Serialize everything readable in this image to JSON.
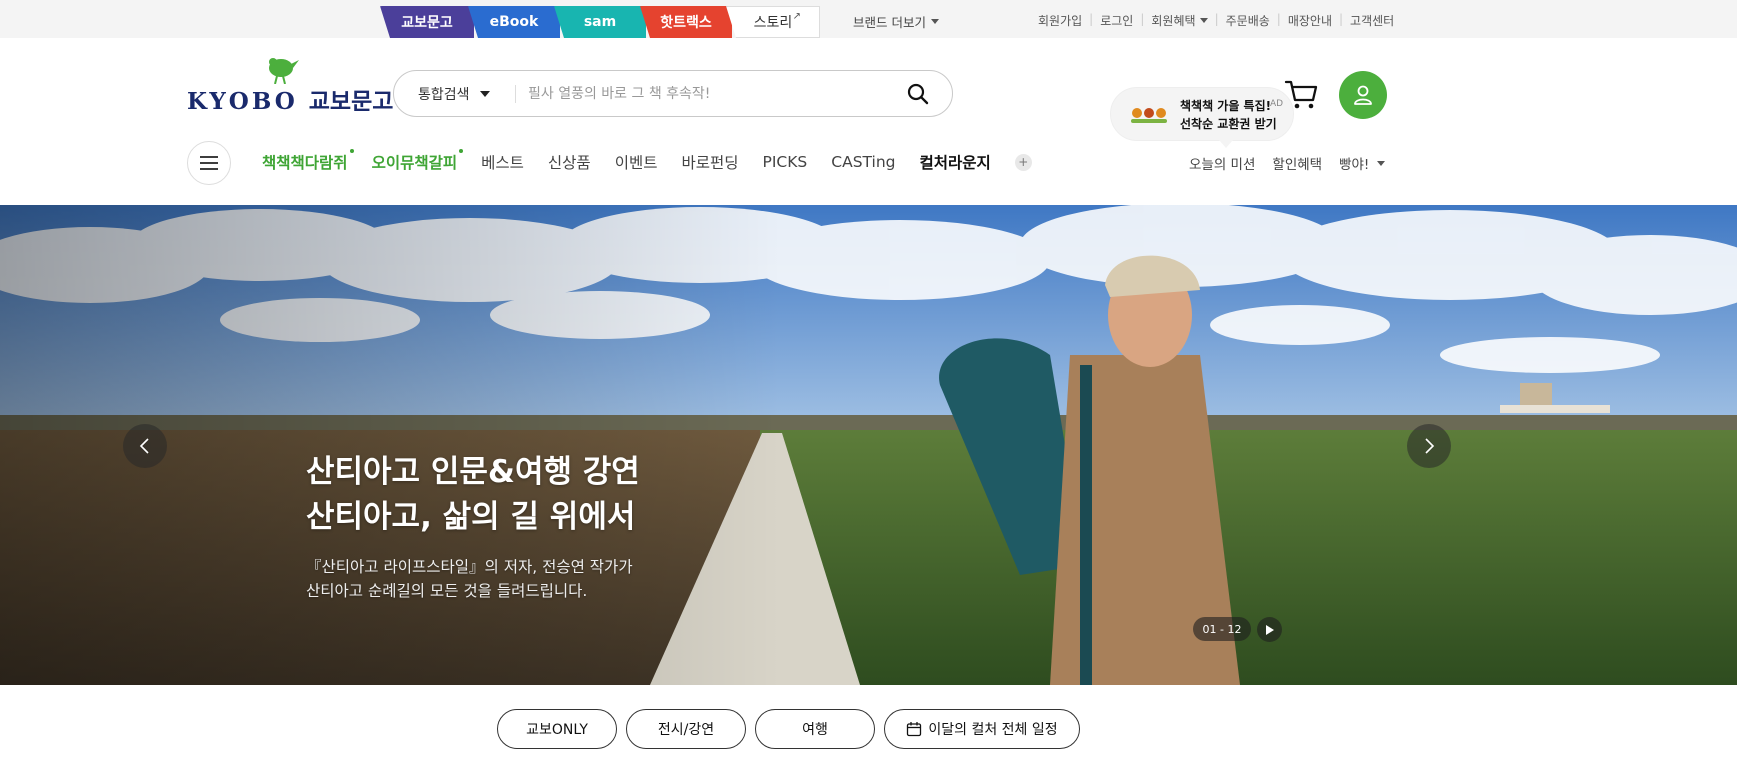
{
  "topbar": {
    "brand_tabs": [
      {
        "label": "교보문고",
        "color": "#4b3f9a"
      },
      {
        "label": "eBook",
        "color": "#2a6cd0"
      },
      {
        "label": "sam",
        "color": "#18b5b0"
      },
      {
        "label": "핫트랙스",
        "color": "#e5432f"
      },
      {
        "label": "스토리",
        "icon": "external-link-icon"
      }
    ],
    "brand_more": "브랜드 더보기",
    "util_links": [
      "회원가입",
      "로그인",
      "회원혜택",
      "주문배송",
      "매장안내",
      "고객센터"
    ]
  },
  "header": {
    "logo_text": "KYOBO",
    "logo_korean": "교보문고",
    "search_type": "통합검색",
    "search_placeholder": "필사 열풍의 바로 그 책 후속작!",
    "ad": {
      "line1": "책책책 가을 특집!",
      "line2": "선착순 교환권 받기",
      "tag": "AD"
    },
    "icons": [
      "search-icon",
      "cart-icon",
      "user-icon"
    ]
  },
  "gnb": {
    "items": [
      "책책책다람쥐",
      "오이뮤책갈피",
      "베스트",
      "신상품",
      "이벤트",
      "바로펀딩",
      "PICKS",
      "CASTing",
      "컬처라운지"
    ],
    "right": [
      "오늘의 미션",
      "할인혜택",
      "빵야!"
    ]
  },
  "hero": {
    "title_line1": "산티아고 인문&여행 강연",
    "title_line2": "산티아고, 삶의 길 위에서",
    "desc_line1": "『산티아고 라이프스타일』의 저자, 전승연 작가가",
    "desc_line2": "산티아고 순례길의 모든 것을 들려드립니다.",
    "counter": "01 - 12"
  },
  "chips": [
    "교보ONLY",
    "전시/강연",
    "여행",
    "이달의 컬처 전체 일정"
  ],
  "colors": {
    "brand_green": "#4caf3d",
    "brand_navy": "#1a2a6c",
    "gnb_green": "#3fa535"
  }
}
